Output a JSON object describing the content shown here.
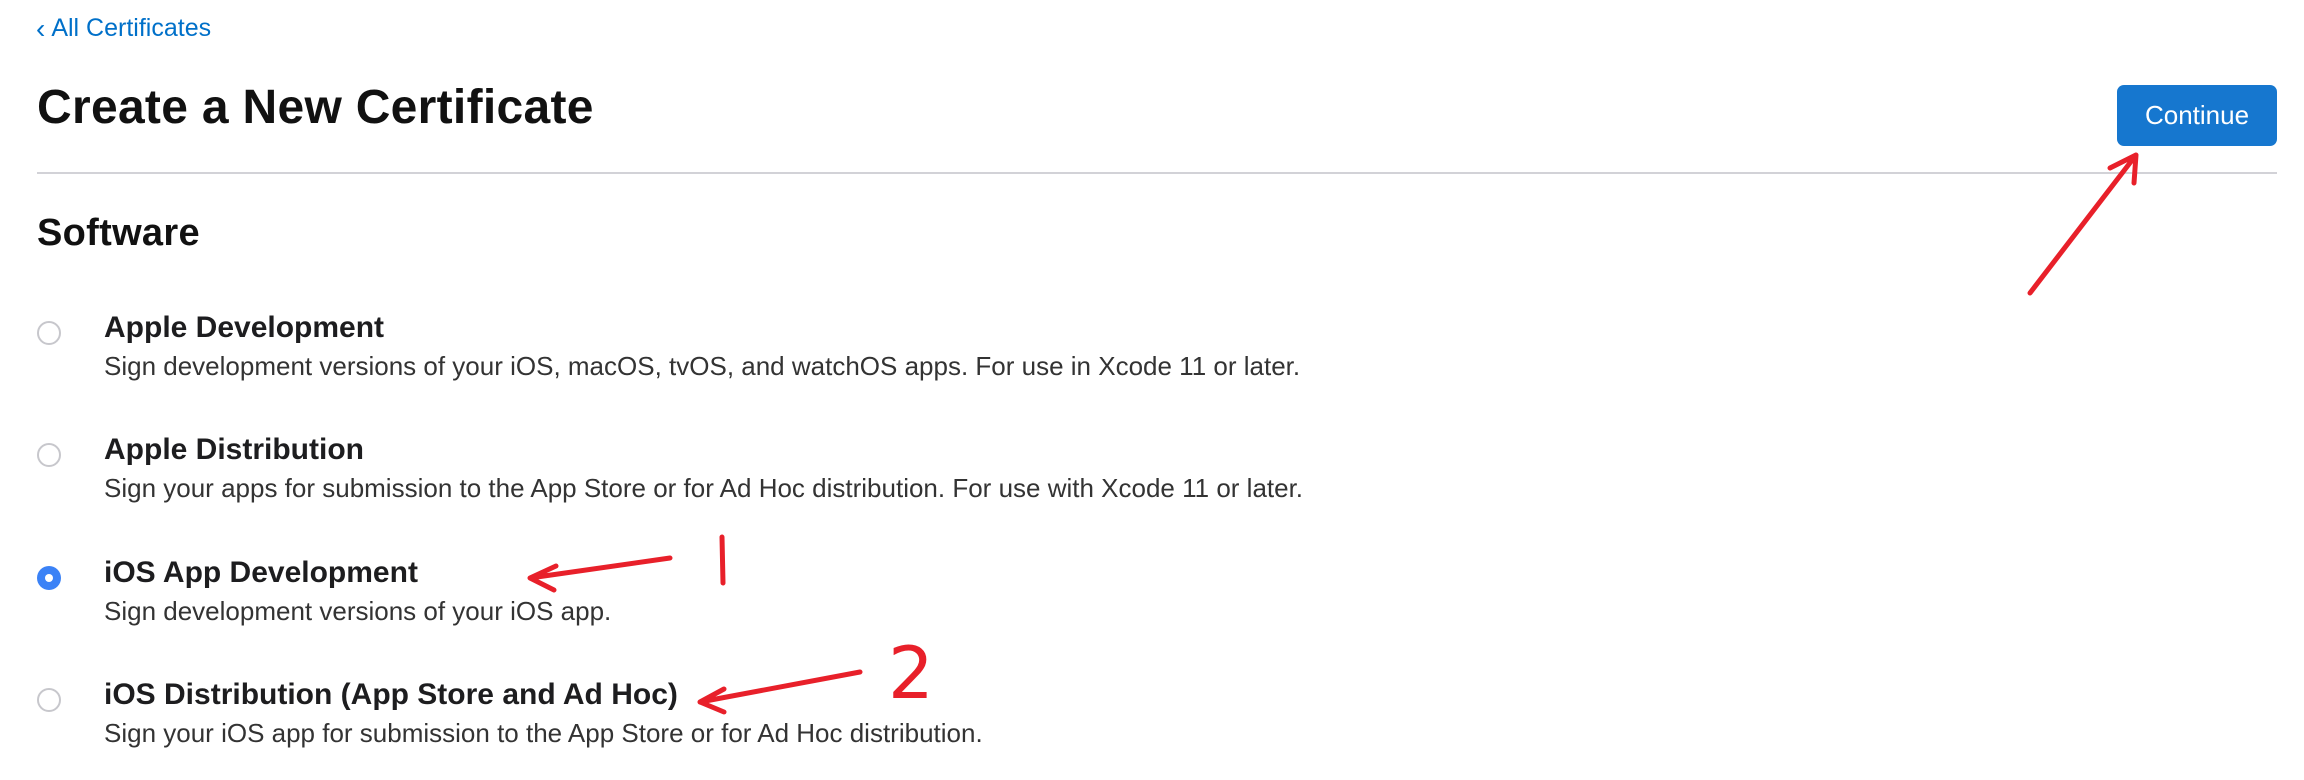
{
  "nav": {
    "back_chevron": "‹",
    "back_label": "All Certificates"
  },
  "header": {
    "title": "Create a New Certificate",
    "continue_label": "Continue"
  },
  "section": {
    "title": "Software"
  },
  "options": [
    {
      "title": "Apple Development",
      "description": "Sign development versions of your iOS, macOS, tvOS, and watchOS apps. For use in Xcode 11 or later.",
      "selected": false
    },
    {
      "title": "Apple Distribution",
      "description": "Sign your apps for submission to the App Store or for Ad Hoc distribution. For use with Xcode 11 or later.",
      "selected": false
    },
    {
      "title": "iOS App Development",
      "description": "Sign development versions of your iOS app.",
      "selected": true
    },
    {
      "title": "iOS Distribution (App Store and Ad Hoc)",
      "description": "Sign your iOS app for submission to the App Store or for Ad Hoc distribution.",
      "selected": false
    }
  ],
  "annotations": {
    "mark_1": "1",
    "mark_2": "2",
    "ink_color": "#e8202a"
  },
  "colors": {
    "accent": "#0070c9",
    "button": "#1677cf",
    "radio_selected": "#3b82f6"
  }
}
